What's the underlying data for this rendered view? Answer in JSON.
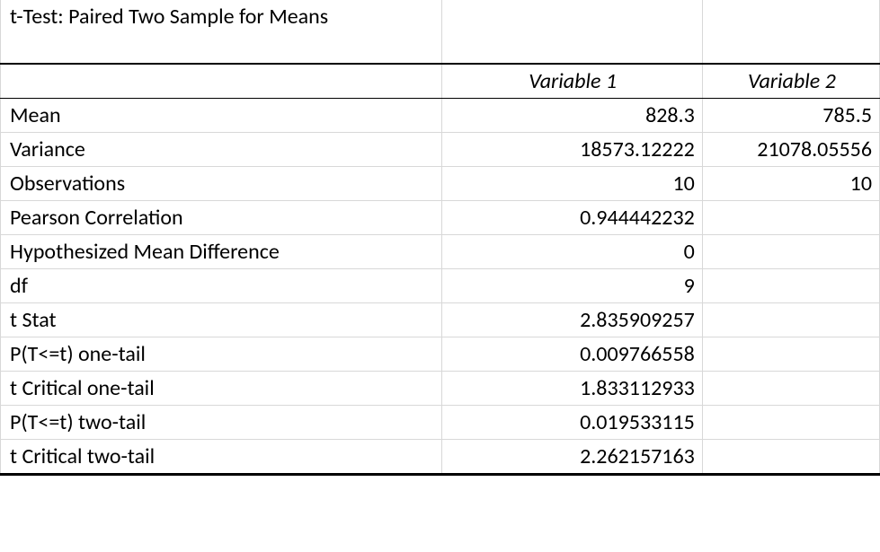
{
  "title": "t-Test: Paired Two Sample for Means",
  "headers": {
    "var1": "Variable 1",
    "var2": "Variable 2"
  },
  "rows": [
    {
      "label": "Mean",
      "v1": "828.3",
      "v2": "785.5"
    },
    {
      "label": "Variance",
      "v1": "18573.12222",
      "v2": "21078.05556"
    },
    {
      "label": "Observations",
      "v1": "10",
      "v2": "10"
    },
    {
      "label": "Pearson Correlation",
      "v1": "0.944442232",
      "v2": ""
    },
    {
      "label": "Hypothesized Mean Difference",
      "v1": "0",
      "v2": ""
    },
    {
      "label": "df",
      "v1": "9",
      "v2": ""
    },
    {
      "label": "t Stat",
      "v1": "2.835909257",
      "v2": ""
    },
    {
      "label": "P(T<=t) one-tail",
      "v1": "0.009766558",
      "v2": ""
    },
    {
      "label": "t Critical one-tail",
      "v1": "1.833112933",
      "v2": ""
    },
    {
      "label": "P(T<=t) two-tail",
      "v1": "0.019533115",
      "v2": ""
    },
    {
      "label": "t Critical two-tail",
      "v1": "2.262157163",
      "v2": ""
    }
  ],
  "chart_data": {
    "type": "table",
    "title": "t-Test: Paired Two Sample for Means",
    "columns": [
      "",
      "Variable 1",
      "Variable 2"
    ],
    "data": [
      [
        "Mean",
        828.3,
        785.5
      ],
      [
        "Variance",
        18573.12222,
        21078.05556
      ],
      [
        "Observations",
        10,
        10
      ],
      [
        "Pearson Correlation",
        0.944442232,
        null
      ],
      [
        "Hypothesized Mean Difference",
        0,
        null
      ],
      [
        "df",
        9,
        null
      ],
      [
        "t Stat",
        2.835909257,
        null
      ],
      [
        "P(T<=t) one-tail",
        0.009766558,
        null
      ],
      [
        "t Critical one-tail",
        1.833112933,
        null
      ],
      [
        "P(T<=t) two-tail",
        0.019533115,
        null
      ],
      [
        "t Critical two-tail",
        2.262157163,
        null
      ]
    ]
  }
}
